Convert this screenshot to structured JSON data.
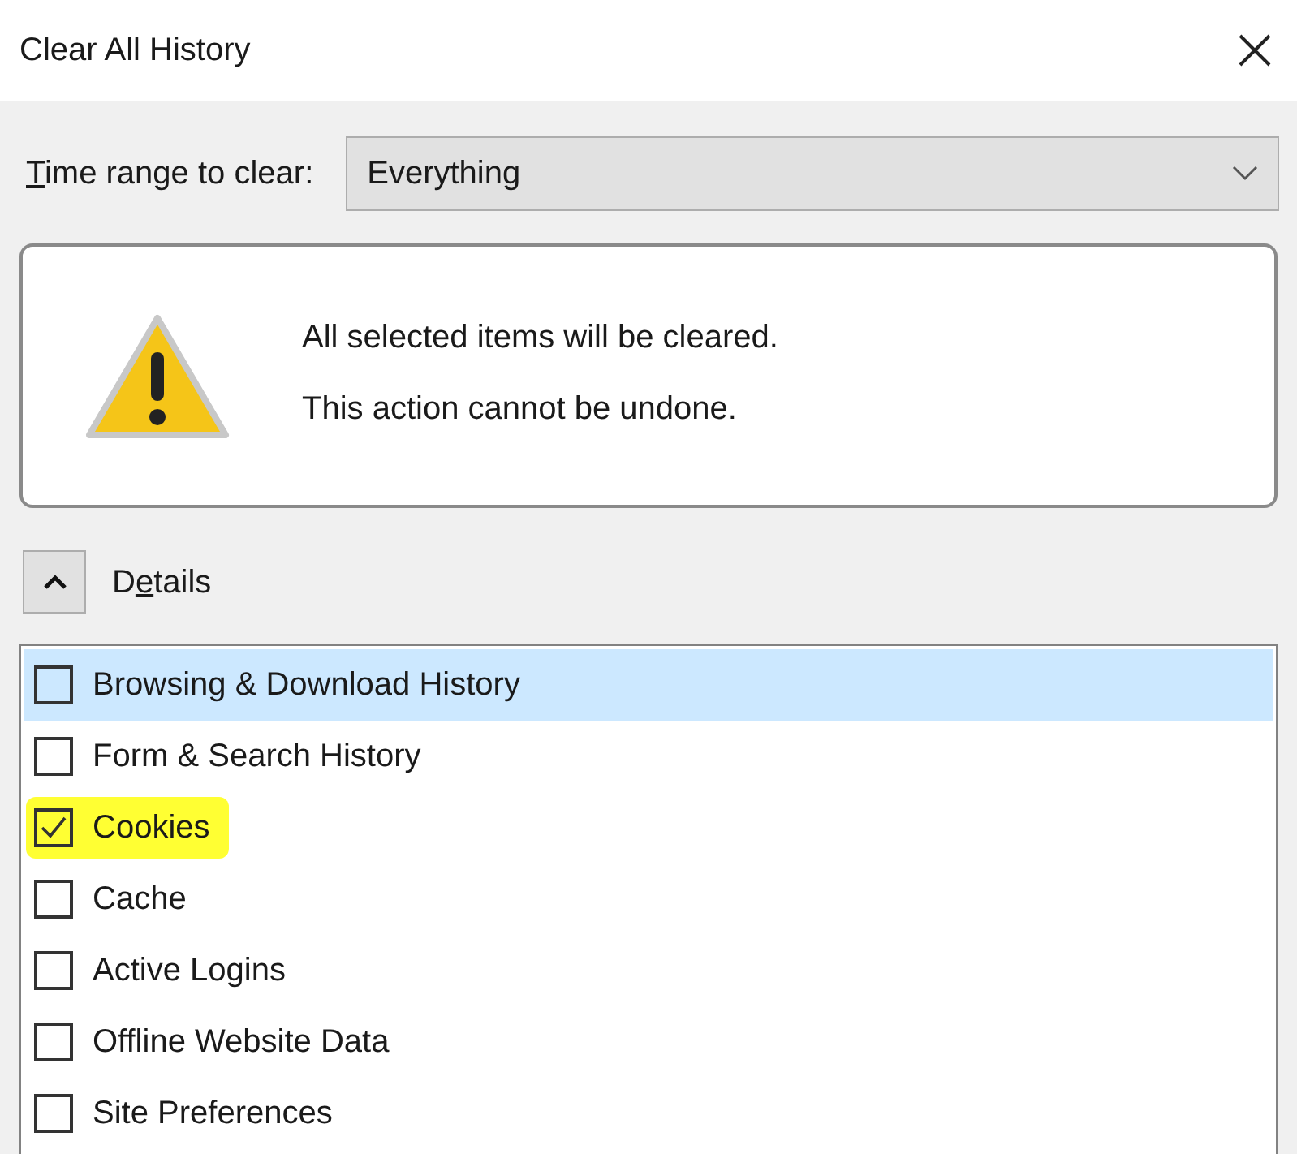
{
  "window": {
    "title": "Clear All History"
  },
  "time_range": {
    "label": [
      {
        "text": "T",
        "underline": true
      },
      {
        "text": "ime range to clear:",
        "underline": false
      }
    ],
    "value": "Everything"
  },
  "warning": {
    "lines": [
      "All selected items will be cleared.",
      "This action cannot be undone."
    ]
  },
  "details": {
    "expanded": true,
    "label": [
      {
        "text": "D",
        "underline": false
      },
      {
        "text": "e",
        "underline": true
      },
      {
        "text": "tails",
        "underline": false
      }
    ]
  },
  "items": [
    {
      "label": "Browsing & Download History",
      "checked": false,
      "selected": true,
      "highlighted": false
    },
    {
      "label": "Form & Search History",
      "checked": false,
      "selected": false,
      "highlighted": false
    },
    {
      "label": "Cookies",
      "checked": true,
      "selected": false,
      "highlighted": true
    },
    {
      "label": "Cache",
      "checked": false,
      "selected": false,
      "highlighted": false
    },
    {
      "label": "Active Logins",
      "checked": false,
      "selected": false,
      "highlighted": false
    },
    {
      "label": "Offline Website Data",
      "checked": false,
      "selected": false,
      "highlighted": false
    },
    {
      "label": "Site Preferences",
      "checked": false,
      "selected": false,
      "highlighted": false
    }
  ]
}
